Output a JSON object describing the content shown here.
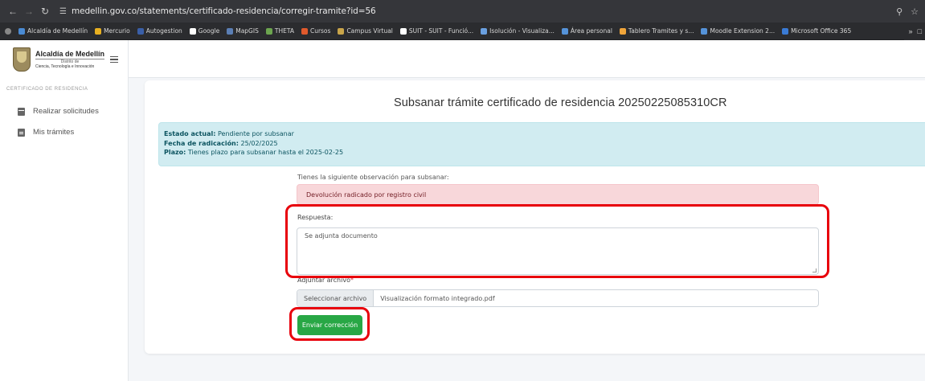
{
  "browser": {
    "url": "medellin.gov.co/statements/certificado-residencia/corregir-tramite?id=56",
    "bookmarks": [
      {
        "label": "Alcaldía de Medellín",
        "color": "#4a8bd4"
      },
      {
        "label": "Mercurio",
        "color": "#e8b021"
      },
      {
        "label": "Autogestion",
        "color": "#3a5fa8"
      },
      {
        "label": "Google",
        "color": "#ffffff"
      },
      {
        "label": "MapGIS",
        "color": "#5b7fb5"
      },
      {
        "label": "THETA",
        "color": "#6ca54f"
      },
      {
        "label": "Cursos",
        "color": "#e05a2c"
      },
      {
        "label": "Campus Virtual",
        "color": "#c9a54a"
      },
      {
        "label": "SUIT - SUIT - Funció...",
        "color": "#ffffff"
      },
      {
        "label": "Isolución - Visualiza...",
        "color": "#6aa0e0"
      },
      {
        "label": "Área personal",
        "color": "#5593d9"
      },
      {
        "label": "Tablero Tramites y s...",
        "color": "#f0a53a"
      },
      {
        "label": "Moodle Extension 2...",
        "color": "#5593d9"
      },
      {
        "label": "Microsoft Office 365",
        "color": "#3a7bd5"
      }
    ]
  },
  "header": {
    "logo_title": "Alcaldía de Medellín",
    "logo_sub1": "Distrito de",
    "logo_sub2": "Ciencia, Tecnología e Innovación"
  },
  "sidebar": {
    "section": "CERTIFICADO DE RESIDENCIA",
    "items": [
      {
        "label": "Realizar solicitudes"
      },
      {
        "label": "Mis trámites"
      }
    ]
  },
  "main": {
    "title": "Subsanar trámite certificado de residencia 20250225085310CR",
    "status_label": "Estado actual:",
    "status_value": "Pendiente por subsanar",
    "date_label": "Fecha de radicación:",
    "date_value": "25/02/2025",
    "deadline_label": "Plazo:",
    "deadline_value": "Tienes plazo para subsanar hasta el 2025-02-25",
    "observation_label": "Tienes la siguiente observación para subsanar:",
    "observation_text": "Devolución radicado por registro civil",
    "response_label": "Respuesta:",
    "response_value": "Se adjunta documento",
    "attach_label": "Adjuntar archivo",
    "attach_required": "*",
    "file_button": "Seleccionar archivo",
    "file_name": "Visualización formato integrado.pdf",
    "submit_label": "Enviar corrección"
  },
  "colors": {
    "annotation": "#e8000b",
    "submit": "#28a745",
    "info_bg": "#d1ecf1",
    "danger_bg": "#f8d7da"
  }
}
